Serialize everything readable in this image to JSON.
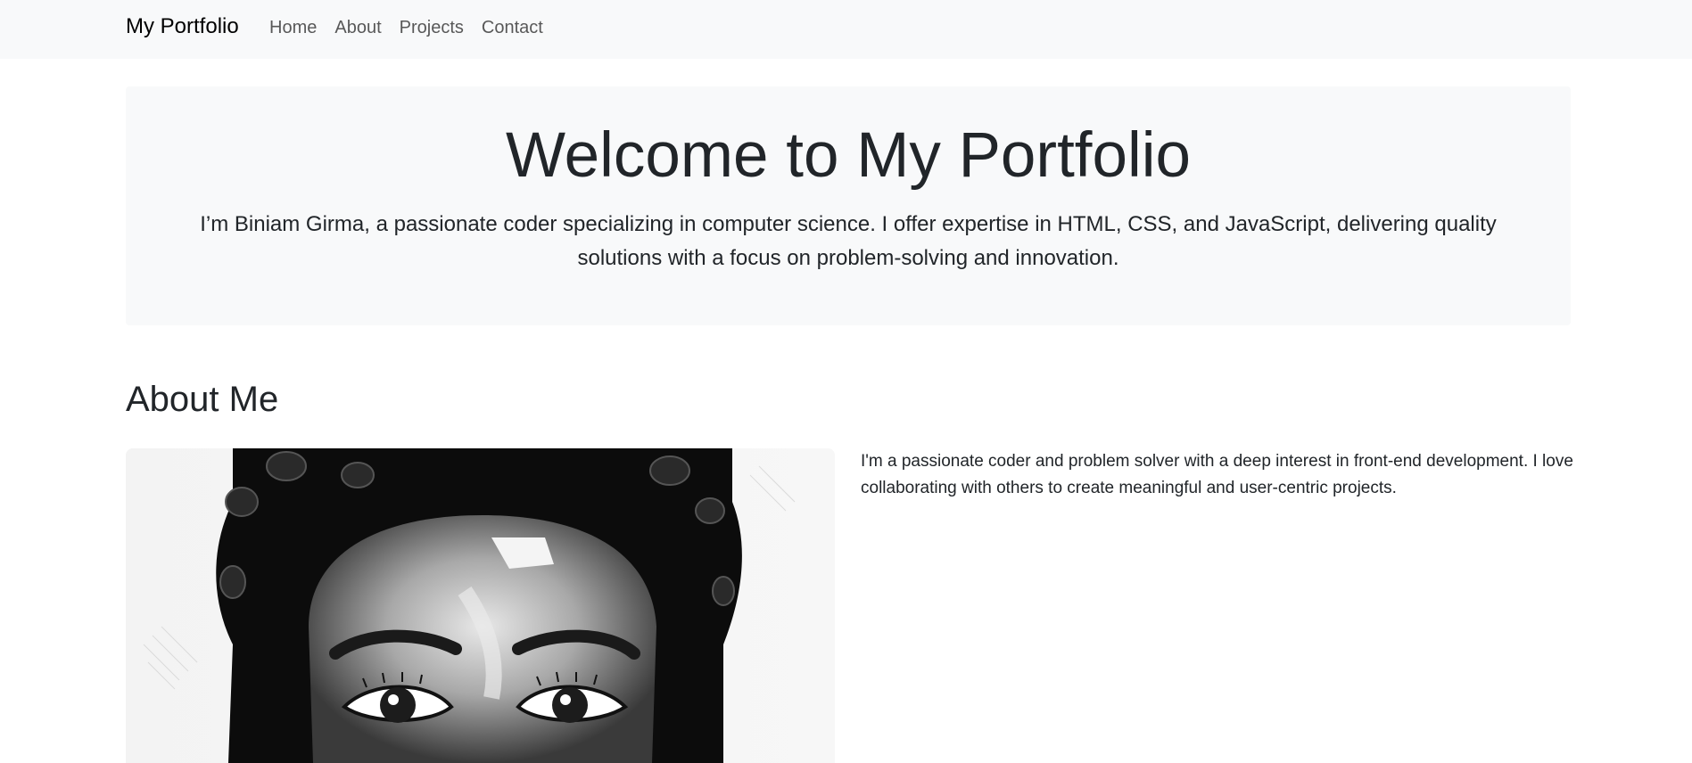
{
  "navbar": {
    "brand": "My Portfolio",
    "links": [
      "Home",
      "About",
      "Projects",
      "Contact"
    ]
  },
  "hero": {
    "title": "Welcome to My Portfolio",
    "lead": "I’m Biniam Girma, a passionate coder specializing in computer science. I offer expertise in HTML, CSS, and JavaScript, delivering quality solutions with a focus on problem-solving and innovation."
  },
  "about": {
    "title": "About Me",
    "text": "I'm a passionate coder and problem solver with a deep interest in front-end development. I love collaborating with others to create meaningful and user-centric projects.",
    "photo_icon": "portrait-illustration"
  },
  "colors": {
    "navbar_bg": "#f8f9fa",
    "hero_bg": "#f8f9fa",
    "text": "#212529"
  }
}
